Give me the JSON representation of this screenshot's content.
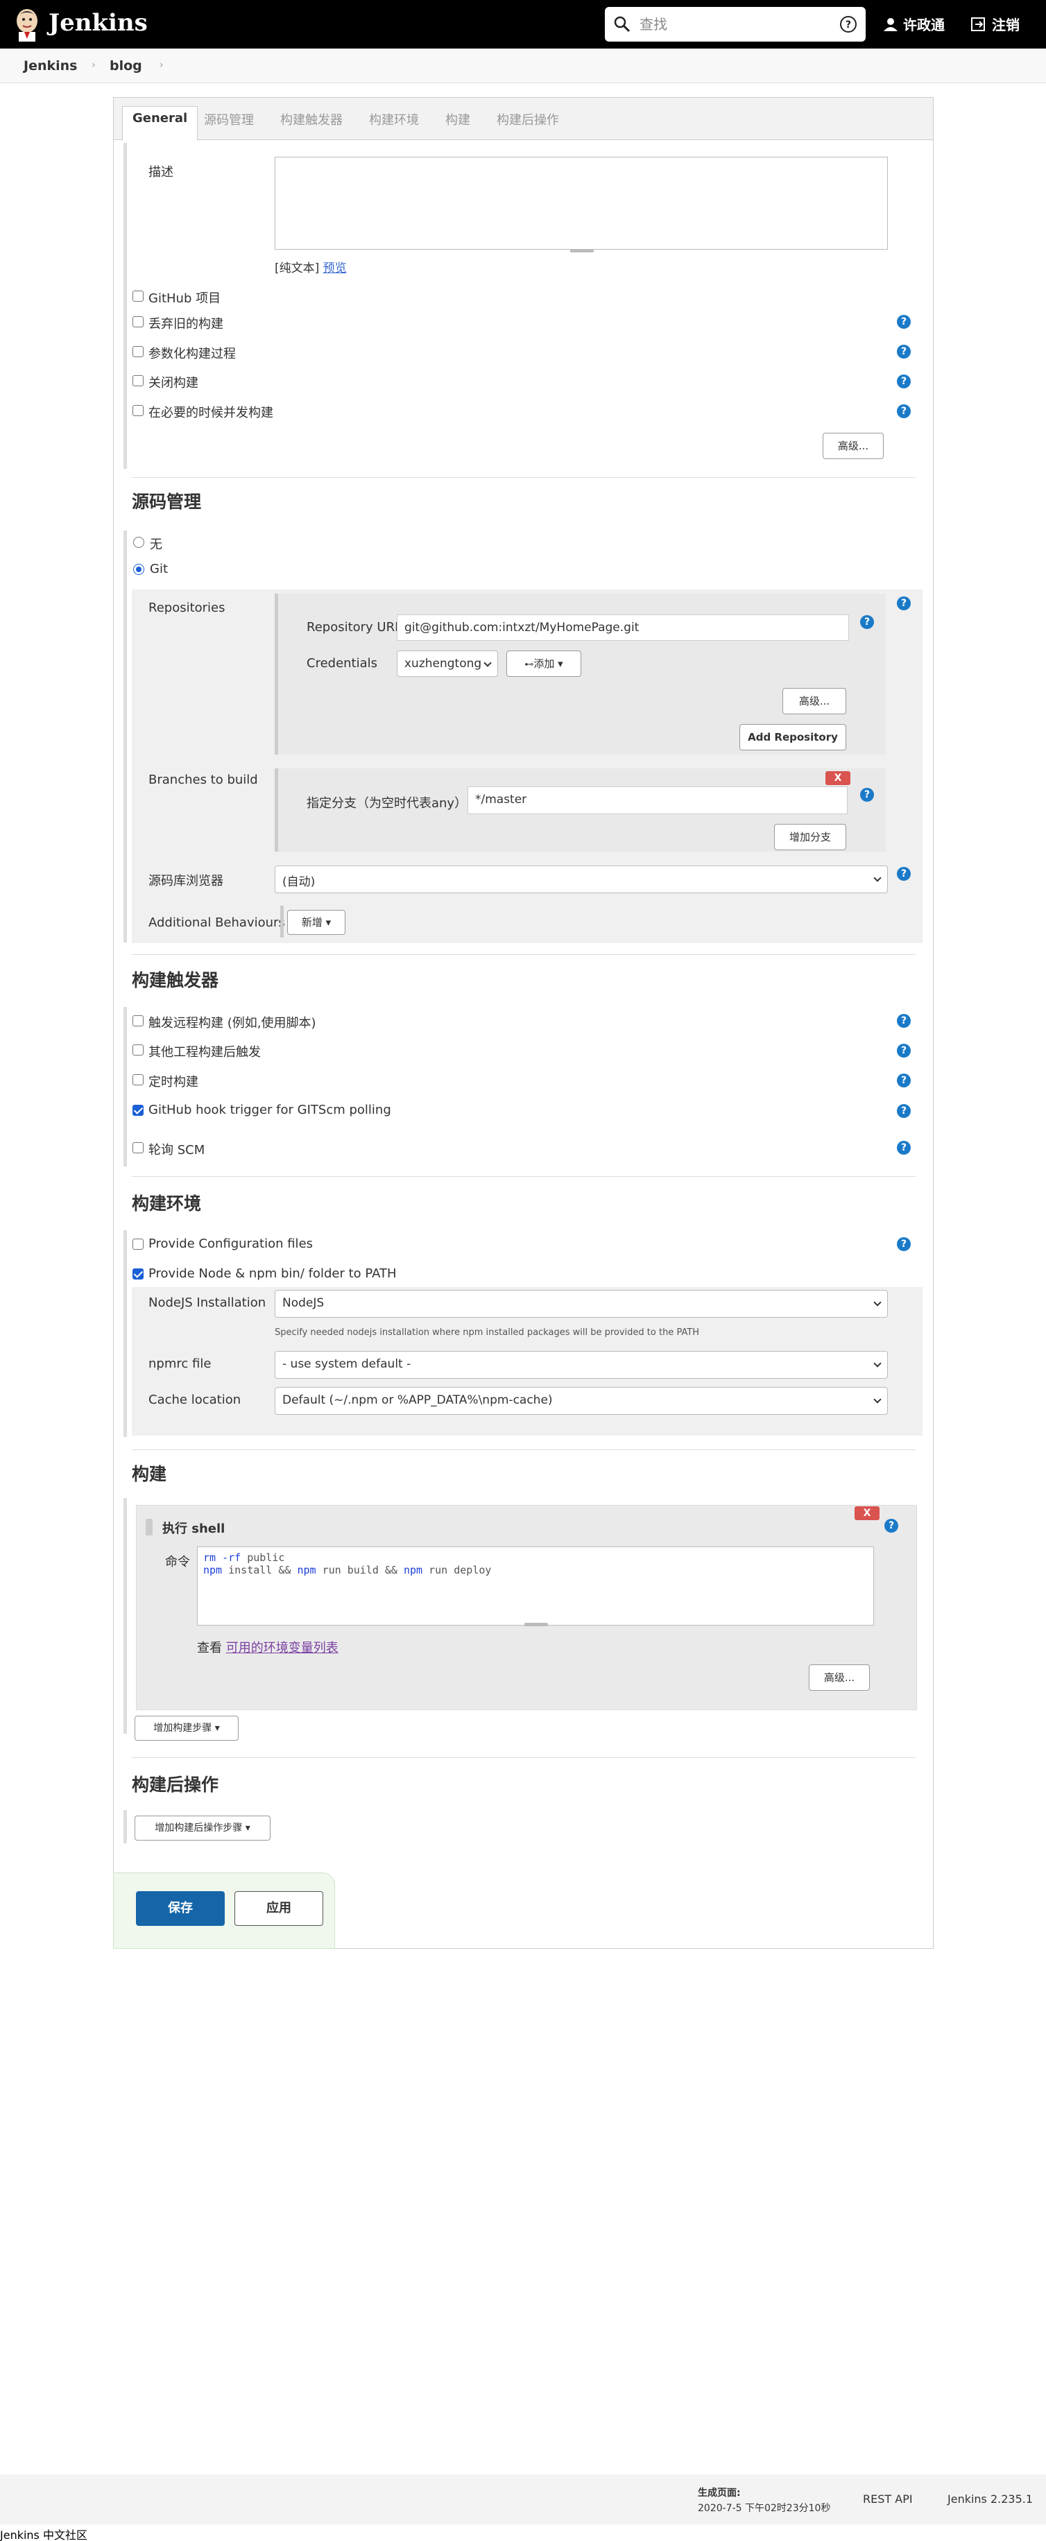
{
  "header": {
    "brand": "Jenkins",
    "search_placeholder": "查找",
    "user": "许政通",
    "logout": "注销"
  },
  "breadcrumb": [
    "Jenkins",
    "blog"
  ],
  "tabs": [
    "General",
    "源码管理",
    "构建触发器",
    "构建环境",
    "构建",
    "构建后操作"
  ],
  "general": {
    "description_label": "描述",
    "plain_text": "[纯文本]",
    "preview": "预览",
    "options": [
      {
        "label": "GitHub 项目",
        "checked": false,
        "help": false
      },
      {
        "label": "丢弃旧的构建",
        "checked": false,
        "help": true
      },
      {
        "label": "参数化构建过程",
        "checked": false,
        "help": true
      },
      {
        "label": "关闭构建",
        "checked": false,
        "help": true
      },
      {
        "label": "在必要的时候并发构建",
        "checked": false,
        "help": true
      }
    ],
    "advanced": "高级..."
  },
  "scm": {
    "title": "源码管理",
    "none": "无",
    "git": "Git",
    "repositories_label": "Repositories",
    "repo_url_label": "Repository URL",
    "repo_url": "git@github.com:intxzt/MyHomePage.git",
    "credentials_label": "Credentials",
    "credentials": "xuzhengtong",
    "add": "添加",
    "advanced": "高级...",
    "add_repository": "Add Repository",
    "branches_label": "Branches to build",
    "branch_spec_label": "指定分支（为空时代表any）",
    "branch_spec": "*/master",
    "add_branch": "增加分支",
    "browser_label": "源码库浏览器",
    "browser": "(自动)",
    "behaviours_label": "Additional Behaviours",
    "new": "新增"
  },
  "triggers": {
    "title": "构建触发器",
    "options": [
      {
        "label": "触发远程构建 (例如,使用脚本)",
        "checked": false
      },
      {
        "label": "其他工程构建后触发",
        "checked": false
      },
      {
        "label": "定时构建",
        "checked": false
      },
      {
        "label": "GitHub hook trigger for GITScm polling",
        "checked": true
      },
      {
        "label": "轮询 SCM",
        "checked": false
      }
    ]
  },
  "environment": {
    "title": "构建环境",
    "provide_config": "Provide Configuration files",
    "provide_node": "Provide Node & npm bin/ folder to PATH",
    "nodejs_label": "NodeJS Installation",
    "nodejs": "NodeJS",
    "nodejs_hint": "Specify needed nodejs installation where npm installed packages will be provided to the PATH",
    "npmrc_label": "npmrc file",
    "npmrc": "- use system default -",
    "cache_label": "Cache location",
    "cache": "Default (~/.npm or %APP_DATA%\\npm-cache)"
  },
  "build": {
    "title": "构建",
    "step_title": "执行 shell",
    "command_label": "命令",
    "see": "查看",
    "env_link": "可用的环境变量列表",
    "advanced": "高级...",
    "add_step": "增加构建步骤"
  },
  "post_build": {
    "title": "构建后操作",
    "add_step": "增加构建后操作步骤"
  },
  "actions": {
    "save": "保存",
    "apply": "应用"
  },
  "footer": {
    "generated_label": "生成页面:",
    "generated_time": "2020-7-5 下午02时23分10秒",
    "rest_api": "REST API",
    "version": "Jenkins 2.235.1",
    "community": "Jenkins 中文社区"
  },
  "colors": {
    "accent": "#1565a8",
    "help": "#1a7ac8",
    "delete": "#d9534f"
  }
}
